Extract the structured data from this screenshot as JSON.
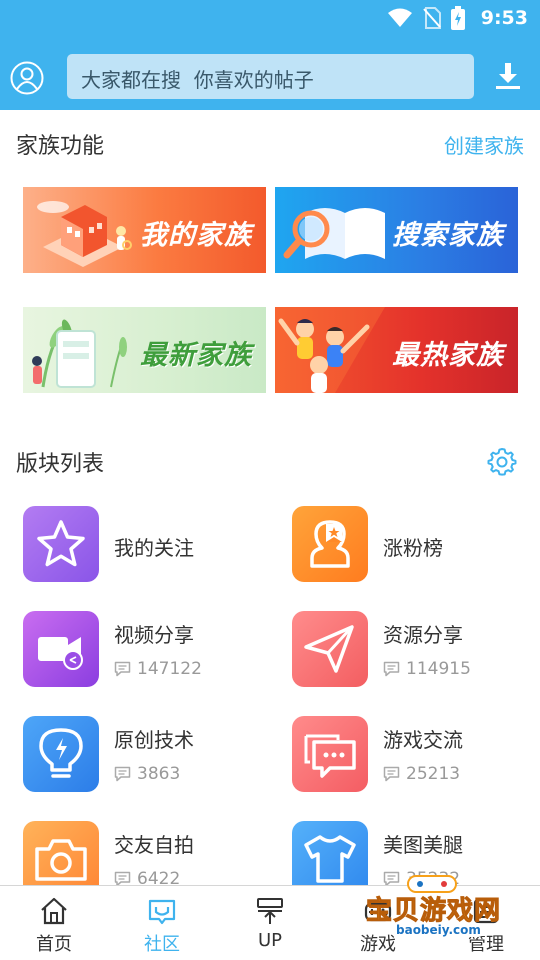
{
  "status_bar": {
    "time": "9:53"
  },
  "search": {
    "placeholder": "大家都在搜  你喜欢的帖子"
  },
  "family": {
    "title": "家族功能",
    "create_label": "创建家族",
    "banners": [
      {
        "label": "我的家族",
        "color": "#fb7b41"
      },
      {
        "label": "搜索家族",
        "color": "#2b7ee4"
      },
      {
        "label": "最新家族",
        "color": "#3f9e3c"
      },
      {
        "label": "最热家族",
        "color": "#e4322b"
      }
    ]
  },
  "boards": {
    "title": "版块列表",
    "items": [
      {
        "name": "我的关注",
        "icon": "star-icon"
      },
      {
        "name": "涨粉榜",
        "icon": "rank-person-icon"
      },
      {
        "name": "视频分享",
        "count": "147122",
        "icon": "video-camera-icon"
      },
      {
        "name": "资源分享",
        "count": "114915",
        "icon": "paper-plane-icon"
      },
      {
        "name": "原创技术",
        "count": "3863",
        "icon": "lightbulb-icon"
      },
      {
        "name": "游戏交流",
        "count": "25213",
        "icon": "chat-bubbles-icon"
      },
      {
        "name": "交友自拍",
        "count": "6422",
        "icon": "camera-icon"
      },
      {
        "name": "美图美腿",
        "count": "35232",
        "icon": "tshirt-icon"
      }
    ]
  },
  "nav": {
    "items": [
      {
        "label": "首页",
        "icon": "home-icon"
      },
      {
        "label": "社区",
        "icon": "community-icon",
        "active": true
      },
      {
        "label": "UP",
        "icon": "up-icon"
      },
      {
        "label": "游戏",
        "icon": "game-icon"
      },
      {
        "label": "管理",
        "icon": "manage-icon"
      }
    ]
  },
  "watermark": {
    "title": "宝贝游戏网",
    "site": "baobeiy.com"
  },
  "colors": {
    "accent": "#3fb3ee",
    "header": "#3fb3ee",
    "text": "#333333",
    "muted": "#999999"
  }
}
